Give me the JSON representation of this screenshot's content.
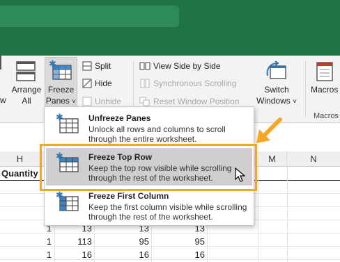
{
  "ribbon": {
    "left_partial": "w",
    "arrange": [
      "Arrange",
      "All"
    ],
    "freeze": [
      "Freeze",
      "Panes"
    ],
    "chevron": "˅",
    "split": "Split",
    "hide": "Hide",
    "unhide": "Unhide",
    "view_side": "View Side by Side",
    "sync_scroll": "Synchronous Scrolling",
    "reset_pos": "Reset Window Position",
    "switch": [
      "Switch",
      "Windows"
    ],
    "macros": "Macros",
    "macros_group": "Macros"
  },
  "sheet": {
    "columns": [
      "H",
      "M",
      "N"
    ],
    "header_cell": "Quantity",
    "rows": [
      [
        "1",
        "13",
        "13",
        "13"
      ],
      [
        "1",
        "113",
        "95",
        "95"
      ],
      [
        "1",
        "16",
        "16",
        "16"
      ]
    ]
  },
  "menu": {
    "items": [
      {
        "title": "Unfreeze Panes",
        "desc": "Unlock all rows and columns to scroll through the entire worksheet."
      },
      {
        "title": "Freeze Top Row",
        "desc": "Keep the top row visible while scrolling through the rest of the worksheet."
      },
      {
        "title": "Freeze First Column",
        "desc": "Keep the first column visible while scrolling through the rest of the worksheet."
      }
    ]
  },
  "colors": {
    "excel_green": "#217346",
    "highlight": "#f5a623",
    "icon_blue": "#2e75b6"
  },
  "icons": [
    "arrange-icon",
    "freeze-panes-icon",
    "split-icon",
    "hide-icon",
    "unhide-icon",
    "view-side-icon",
    "sync-scroll-icon",
    "reset-position-icon",
    "switch-windows-icon",
    "macros-icon",
    "arrow-annotation",
    "mouse-cursor-icon"
  ]
}
